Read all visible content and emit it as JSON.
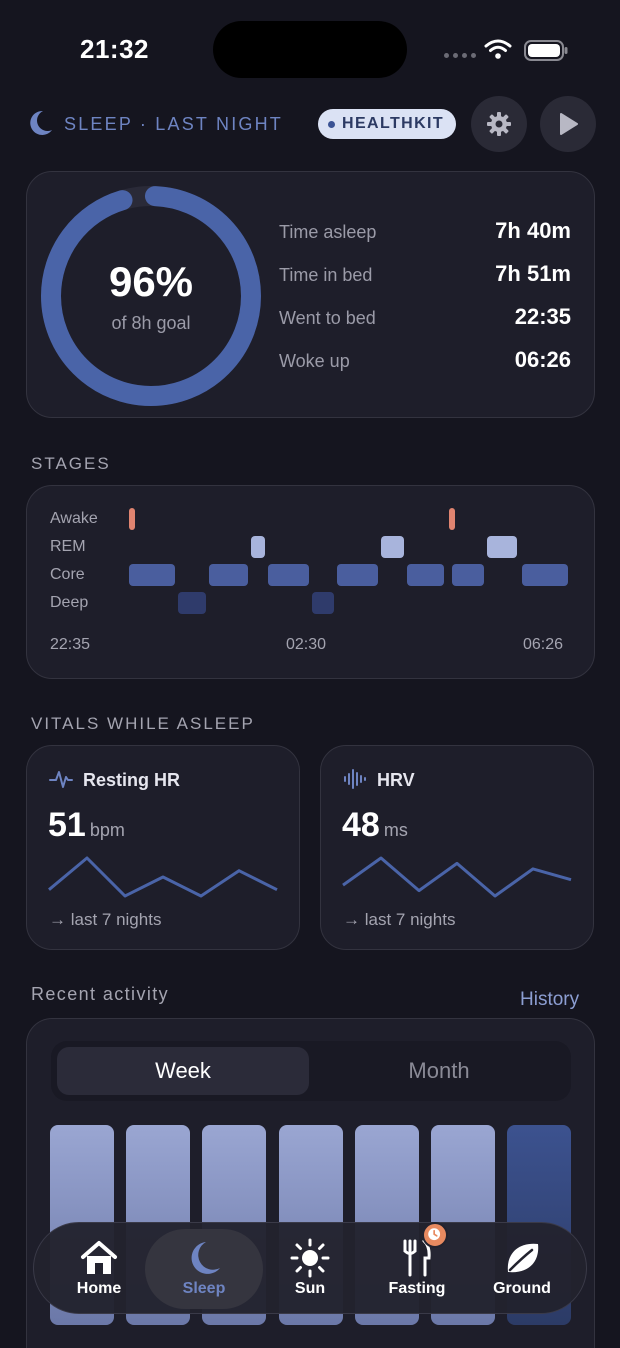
{
  "status_bar": {
    "time": "21:32"
  },
  "header": {
    "title": "SLEEP · LAST NIGHT",
    "badge": "HEALTHKIT"
  },
  "summary": {
    "percent": "96%",
    "goal": "of 8h goal",
    "progress": 0.96,
    "stats": [
      {
        "label": "Time asleep",
        "value": "7h 40m"
      },
      {
        "label": "Time in bed",
        "value": "7h 51m"
      },
      {
        "label": "Went to bed",
        "value": "22:35"
      },
      {
        "label": "Woke up",
        "value": "06:26"
      }
    ]
  },
  "stages": {
    "title": "STAGES",
    "levels": [
      "Awake",
      "REM",
      "Core",
      "Deep"
    ],
    "times": [
      "22:35",
      "02:30",
      "06:26"
    ],
    "segments": [
      {
        "stage": "Awake",
        "start": 0.0,
        "end": 0.02
      },
      {
        "stage": "Core",
        "start": 0.0,
        "end": 0.11
      },
      {
        "stage": "Deep",
        "start": 0.11,
        "end": 0.18
      },
      {
        "stage": "Core",
        "start": 0.18,
        "end": 0.275
      },
      {
        "stage": "REM",
        "start": 0.275,
        "end": 0.315
      },
      {
        "stage": "Core",
        "start": 0.315,
        "end": 0.415
      },
      {
        "stage": "Deep",
        "start": 0.415,
        "end": 0.47
      },
      {
        "stage": "Core",
        "start": 0.47,
        "end": 0.57
      },
      {
        "stage": "REM",
        "start": 0.57,
        "end": 0.63
      },
      {
        "stage": "Core",
        "start": 0.63,
        "end": 0.72
      },
      {
        "stage": "Awake",
        "start": 0.725,
        "end": 0.74
      },
      {
        "stage": "Core",
        "start": 0.73,
        "end": 0.81
      },
      {
        "stage": "REM",
        "start": 0.81,
        "end": 0.885
      },
      {
        "stage": "Core",
        "start": 0.89,
        "end": 1.0
      }
    ]
  },
  "vitals": {
    "title": "VITALS WHILE ASLEEP",
    "hr": {
      "name": "Resting HR",
      "value": "51",
      "unit": "bpm",
      "footer": "→ last 7 nights",
      "trend": [
        53,
        58,
        52,
        55,
        52,
        56,
        53
      ]
    },
    "hrv": {
      "name": "HRV",
      "value": "48",
      "unit": "ms",
      "footer": "→ last 7 nights",
      "trend": [
        46,
        51,
        45,
        50,
        44,
        49,
        47
      ]
    }
  },
  "recent": {
    "title": "Recent activity",
    "history_link": "History",
    "segments": {
      "week": "Week",
      "month": "Month",
      "selected": "Week"
    },
    "bars": 7
  },
  "tabbar": {
    "tabs": [
      {
        "label": "Home"
      },
      {
        "label": "Sleep"
      },
      {
        "label": "Sun"
      },
      {
        "label": "Fasting"
      },
      {
        "label": "Ground"
      }
    ],
    "active": "Sleep"
  },
  "colors": {
    "accent": "#4a64a8",
    "awake": "#e08470",
    "rem": "#a8b4dc",
    "core": "#4a5e9e",
    "deep": "#2f3b6b"
  }
}
